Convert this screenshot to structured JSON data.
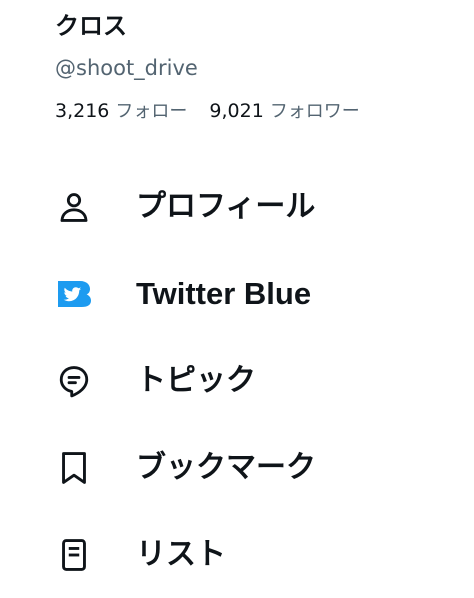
{
  "profile": {
    "display_name": "クロス",
    "handle": "@shoot_drive",
    "following_count": "3,216",
    "following_label": "フォロー",
    "followers_count": "9,021",
    "followers_label": "フォロワー"
  },
  "menu": {
    "items": [
      {
        "label": "プロフィール",
        "icon": "person-icon"
      },
      {
        "label": "Twitter Blue",
        "icon": "twitter-blue-icon"
      },
      {
        "label": "トピック",
        "icon": "topics-icon"
      },
      {
        "label": "ブックマーク",
        "icon": "bookmark-icon"
      },
      {
        "label": "リスト",
        "icon": "lists-icon"
      }
    ]
  },
  "colors": {
    "text_primary": "#0f1419",
    "text_secondary": "#536471",
    "twitter_blue": "#1d9bf0",
    "background": "#ffffff"
  }
}
